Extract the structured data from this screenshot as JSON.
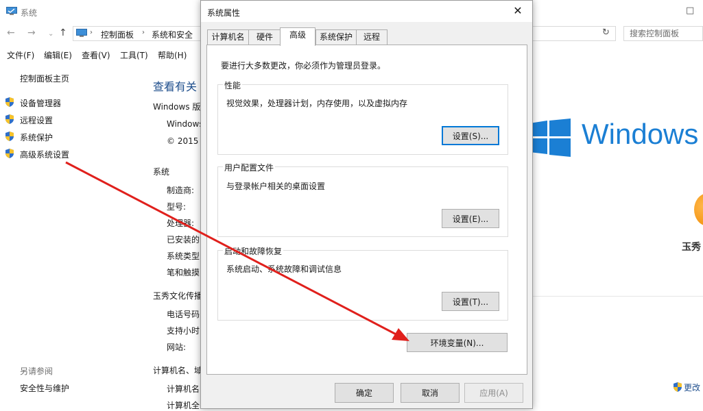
{
  "background_window": {
    "title": "系统",
    "maximize_glyph": "□",
    "address": {
      "crumbs": [
        "控制面板",
        "系统和安全"
      ],
      "search_placeholder": "搜索控制面板"
    },
    "menu": [
      "文件(F)",
      "编辑(E)",
      "查看(V)",
      "工具(T)",
      "帮助(H)"
    ],
    "left_nav": {
      "home": "控制面板主页",
      "links": [
        "设备管理器",
        "远程设置",
        "系统保护",
        "高级系统设置"
      ],
      "see_also_title": "另请参阅",
      "see_also_links": [
        "安全性与维护"
      ]
    },
    "main": {
      "heading": "查看有关",
      "windows_edition_label": "Windows 版",
      "windows_line": "Windows",
      "copyright": "© 2015",
      "system_section": "系统",
      "system_fields": [
        "制造商:",
        "型号:",
        "处理器:",
        "已安装的",
        "系统类型",
        "笔和触摸"
      ],
      "support_section": "玉秀文化传播",
      "support_fields": [
        "电话号码",
        "支持小时",
        "网站:"
      ],
      "computer_section": "计算机名、域",
      "computer_fields": [
        "计算机名",
        "计算机全"
      ],
      "windows_logo_text": "Windows",
      "oem_name": "玉秀",
      "change_settings": "更改"
    }
  },
  "dialog": {
    "title": "系统属性",
    "close_glyph": "✕",
    "tabs": [
      "计算机名",
      "硬件",
      "高级",
      "系统保护",
      "远程"
    ],
    "active_tab": "高级",
    "admin_note": "要进行大多数更改，你必须作为管理员登录。",
    "groups": [
      {
        "title": "性能",
        "desc": "视觉效果，处理器计划，内存使用，以及虚拟内存",
        "button": "设置(S)..."
      },
      {
        "title": "用户配置文件",
        "desc": "与登录帐户相关的桌面设置",
        "button": "设置(E)..."
      },
      {
        "title": "启动和故障恢复",
        "desc": "系统启动、系统故障和调试信息",
        "button": "设置(T)..."
      }
    ],
    "env_button": "环境变量(N)...",
    "ok_button": "确定",
    "cancel_button": "取消",
    "apply_button": "应用(A)"
  },
  "colors": {
    "link_blue": "#1e4e8c",
    "windows_blue": "#1b7fd4",
    "focus_blue": "#0078d7",
    "arrow_red": "#e0201c"
  }
}
